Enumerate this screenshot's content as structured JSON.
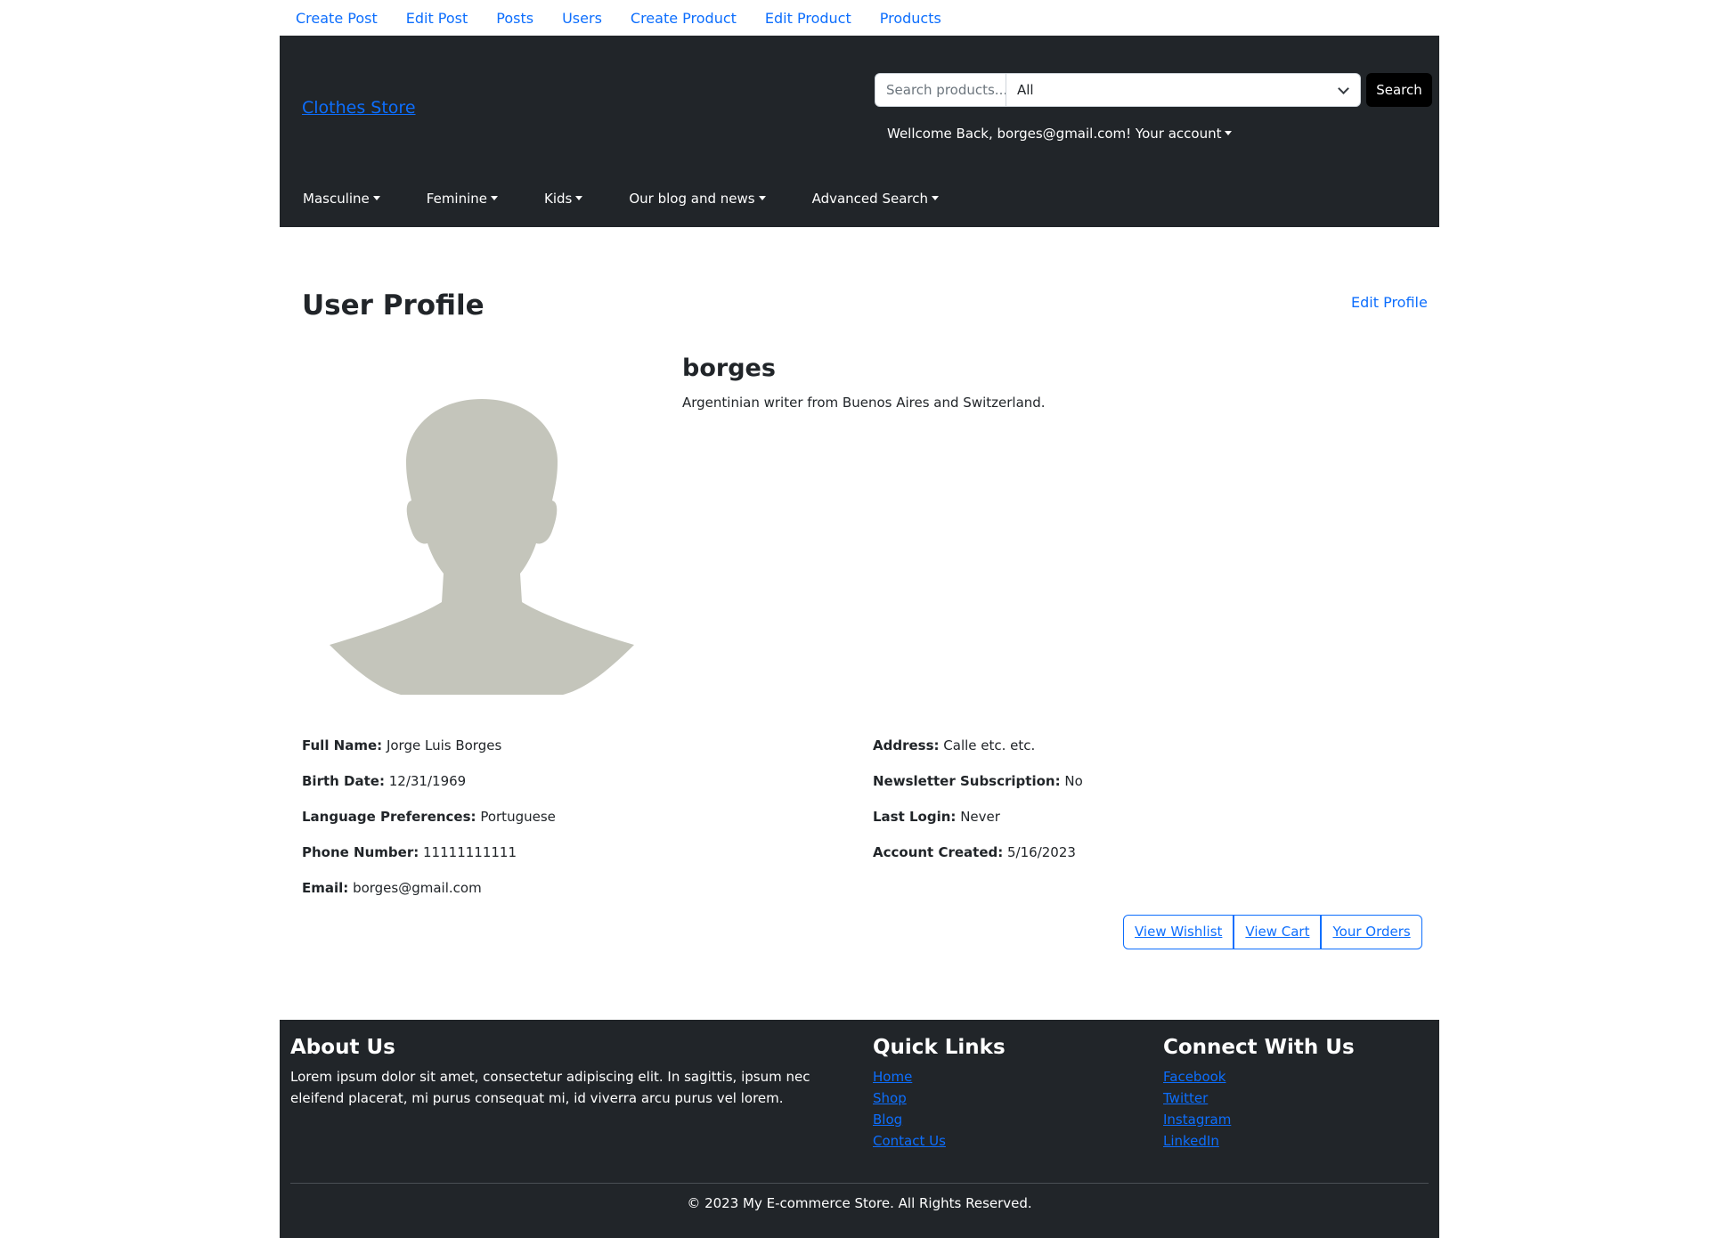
{
  "top_links": [
    "Create Post",
    "Edit Post",
    "Posts",
    "Users",
    "Create Product",
    "Edit Product",
    "Products"
  ],
  "header": {
    "brand": "Clothes Store",
    "search_placeholder": "Search products...",
    "category_selected": "All",
    "search_button": "Search",
    "welcome": "Wellcome Back, borges@gmail.com! Your account"
  },
  "nav": [
    "Masculine",
    "Feminine",
    "Kids",
    "Our blog and news",
    "Advanced Search"
  ],
  "profile": {
    "title": "User Profile",
    "edit_link": "Edit Profile",
    "username": "borges",
    "bio": "Argentinian writer from Buenos Aires and Switzerland.",
    "left_fields": [
      {
        "label": "Full Name:",
        "value": "Jorge Luis Borges"
      },
      {
        "label": "Birth Date:",
        "value": "12/31/1969"
      },
      {
        "label": "Language Preferences:",
        "value": "Portuguese"
      },
      {
        "label": "Phone Number:",
        "value": "11111111111"
      },
      {
        "label": "Email:",
        "value": "borges@gmail.com"
      }
    ],
    "right_fields": [
      {
        "label": "Address:",
        "value": "Calle etc. etc."
      },
      {
        "label": "Newsletter Subscription:",
        "value": "No"
      },
      {
        "label": "Last Login:",
        "value": "Never"
      },
      {
        "label": "Account Created:",
        "value": "5/16/2023"
      }
    ],
    "actions": [
      "View Wishlist",
      "View Cart",
      "Your Orders"
    ]
  },
  "footer": {
    "about_title": "About Us",
    "about_text": "Lorem ipsum dolor sit amet, consectetur adipiscing elit. In sagittis, ipsum nec eleifend placerat, mi purus consequat mi, id viverra arcu purus vel lorem.",
    "quick_title": "Quick Links",
    "quick_links": [
      "Home",
      "Shop",
      "Blog",
      "Contact Us"
    ],
    "connect_title": "Connect With Us",
    "connect_links": [
      "Facebook",
      "Twitter",
      "Instagram",
      "LinkedIn"
    ],
    "copyright": "© 2023 My E-commerce Store. All Rights Reserved."
  },
  "colors": {
    "link": "#0d6efd",
    "header_bg": "#212529",
    "avatar": "#c4c5bb"
  }
}
